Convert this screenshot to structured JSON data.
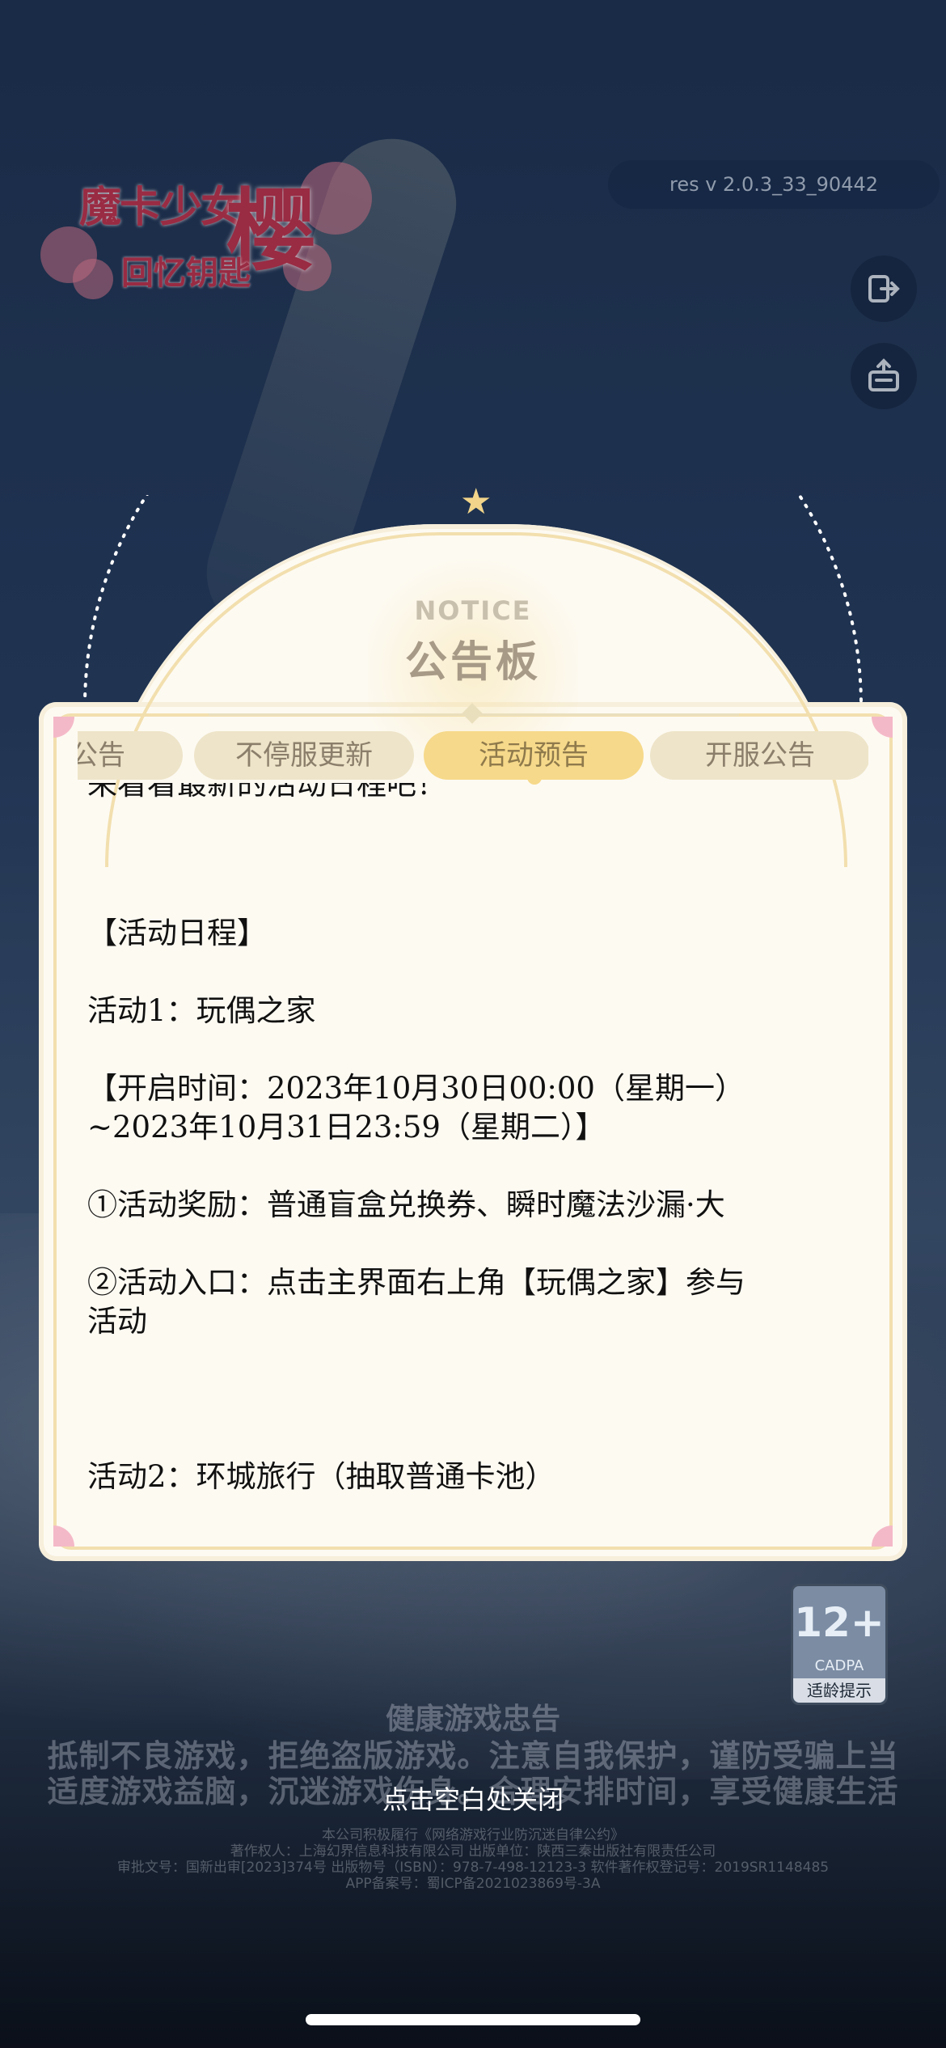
{
  "header": {
    "logo": {
      "title": "魔卡少女",
      "title_big": "樱",
      "subtitle": "回忆钥匙"
    },
    "version": "res v 2.0.3_33_90442",
    "side_buttons": [
      {
        "icon": "logout-icon"
      },
      {
        "icon": "upload-icon"
      }
    ]
  },
  "notice": {
    "eyebrow": "NOTICE",
    "title": "公告板",
    "tabs": [
      {
        "label": "公告",
        "active": false
      },
      {
        "label": "不停服更新",
        "active": false
      },
      {
        "label": "活动预告",
        "active": true
      },
      {
        "label": "开服公告",
        "active": false
      }
    ],
    "content": {
      "cut_line": "来看看最新的活动日程吧！",
      "schedule_heading": "【活动日程】",
      "activity1_title": "活动1：玩偶之家",
      "activity1_time_1": "【开启时间：2023年10月30日00:00（星期一）",
      "activity1_time_2": "~2023年10月31日23:59（星期二）】",
      "activity1_reward": "①活动奖励：普通盲盒兑换券、瞬时魔法沙漏·大",
      "activity1_entry_1": "②活动入口：点击主界面右上角【玩偶之家】参与",
      "activity1_entry_2": "活动",
      "activity2_title": "活动2：环城旅行（抽取普通卡池）"
    }
  },
  "rating": {
    "age": "12+",
    "org": "CADPA",
    "tip": "适龄提示"
  },
  "footer": {
    "health_title": "健康游戏忠告",
    "health_line1": "抵制不良游戏，拒绝盗版游戏。注意自我保护，谨防受骗上当",
    "health_line2": "适度游戏益脑，沉迷游戏伤身。合理安排时间，享受健康生活",
    "close_tip": "点击空白处关闭",
    "legal1": "本公司积极履行《网络游戏行业防沉迷自律公约》",
    "legal2": "著作权人：上海幻界信息科技有限公司 出版单位：陕西三秦出版社有限责任公司",
    "legal3": "审批文号：国新出审[2023]374号 出版物号（ISBN）：978-7-498-12123-3 软件著作权登记号：2019SR1148485",
    "legal4": "APP备案号：蜀ICP备2021023869号-3A"
  },
  "colors": {
    "panel": "#fdfaf2",
    "panel_border": "#f2dfae",
    "tab_active": "#f6d98a",
    "tab_inactive": "#eee4c9",
    "logo_red": "#b33048"
  }
}
